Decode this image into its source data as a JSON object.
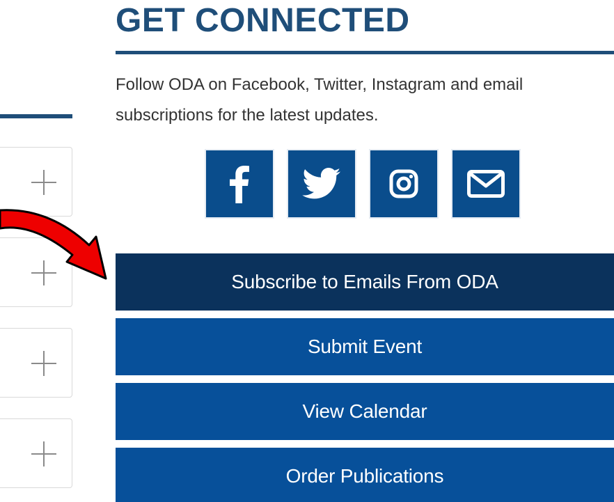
{
  "section": {
    "title": "GET CONNECTED",
    "intro": "Follow ODA on Facebook, Twitter, Instagram and email subscriptions for the latest updates."
  },
  "social_links": [
    {
      "name": "Facebook",
      "icon": "facebook-icon"
    },
    {
      "name": "Twitter",
      "icon": "twitter-icon"
    },
    {
      "name": "Instagram",
      "icon": "instagram-icon"
    },
    {
      "name": "Email",
      "icon": "envelope-icon"
    }
  ],
  "actions": {
    "subscribe_label": "Subscribe to Emails From ODA",
    "submit_event_label": "Submit Event",
    "view_calendar_label": "View Calendar",
    "order_publications_label": "Order Publications"
  },
  "accordion": {
    "toggle_icon": "plus-icon"
  },
  "colors": {
    "brand_blue": "#07509a",
    "navy": "#0b325c",
    "heading_blue": "#1f4e79",
    "annotation_arrow": "#ff0000"
  }
}
